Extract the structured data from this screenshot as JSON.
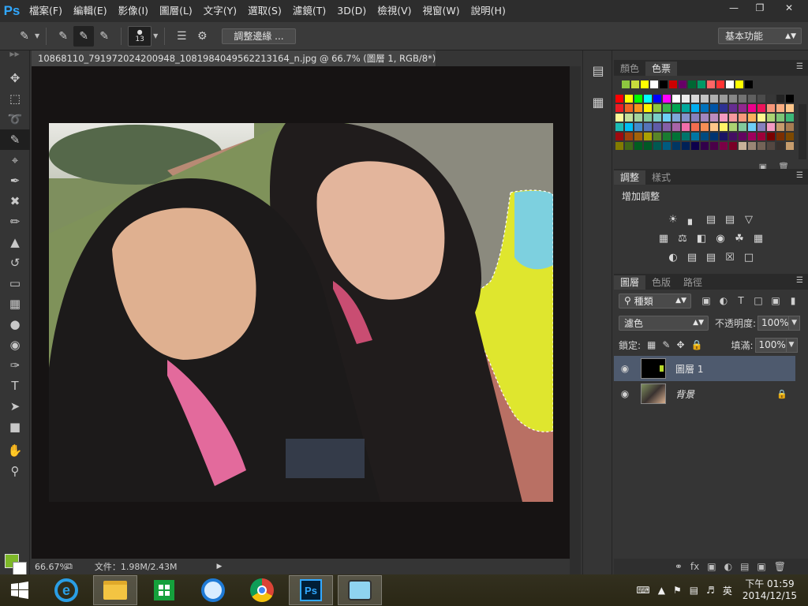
{
  "app": {
    "logo": "Ps",
    "menu": [
      "檔案(F)",
      "編輯(E)",
      "影像(I)",
      "圖層(L)",
      "文字(Y)",
      "選取(S)",
      "濾鏡(T)",
      "3D(D)",
      "檢視(V)",
      "視窗(W)",
      "說明(H)"
    ]
  },
  "options": {
    "brush_size": "13",
    "refine_edge": "調整邊緣 ...",
    "workspace": "基本功能"
  },
  "document": {
    "tab_title": "10868110_791972024200948_1081984049562213164_n.jpg @ 66.7% (圖層 1, RGB/8*) *",
    "close": "×",
    "zoom": "66.67%",
    "doc_info": "文件：1.98M/2.43M"
  },
  "tools": [
    "move-tool-icon",
    "marquee-tool-icon",
    "lasso-tool-icon",
    "quick-selection-tool-icon",
    "crop-tool-icon",
    "eyedropper-tool-icon",
    "healing-tool-icon",
    "brush-tool-icon",
    "stamp-tool-icon",
    "history-brush-tool-icon",
    "eraser-tool-icon",
    "gradient-tool-icon",
    "blur-tool-icon",
    "dodge-tool-icon",
    "pen-tool-icon",
    "type-tool-icon",
    "path-selection-tool-icon",
    "shape-tool-icon",
    "hand-tool-icon",
    "zoom-tool-icon"
  ],
  "colors": {
    "foreground": "#7eb829",
    "background": "#ffffff",
    "selected_layer": "#4e5a6e"
  },
  "swatches_panel": {
    "tabs": [
      "顏色",
      "色票"
    ],
    "recent": [
      "#8dc63f",
      "#c8dc3c",
      "#ffff00",
      "#ffffff",
      "#000000",
      "#cc0000",
      "#660066",
      "#006633",
      "#009966",
      "#ff6666",
      "#ff3333",
      "#ffffff",
      "#ffff00",
      "#000000"
    ],
    "grid": [
      "#ff0000",
      "#ffff00",
      "#00ff00",
      "#00ffff",
      "#0000ff",
      "#ff00ff",
      "#ffffff",
      "#ebebeb",
      "#d7d7d7",
      "#c3c3c3",
      "#afafaf",
      "#9b9b9b",
      "#878787",
      "#737373",
      "#5f5f5f",
      "#4b4b4b",
      "#373737",
      "#232323",
      "#000000",
      "#ed1c24",
      "#f26522",
      "#f7941d",
      "#fff200",
      "#8dc63f",
      "#39b54a",
      "#00a651",
      "#00a99d",
      "#00aeef",
      "#0072bc",
      "#0054a6",
      "#2e3192",
      "#662d91",
      "#92278f",
      "#ec008c",
      "#ed145b",
      "#f69679",
      "#f9ad81",
      "#fdc68a",
      "#fff799",
      "#c4df9b",
      "#a3d39c",
      "#82ca9d",
      "#7accc8",
      "#6dcff6",
      "#7da7d9",
      "#8393ca",
      "#8781bd",
      "#a186be",
      "#bd8cbf",
      "#f49ac1",
      "#f5989d",
      "#f7977a",
      "#fbaf5c",
      "#fff68f",
      "#acd373",
      "#7cc576",
      "#3cb878",
      "#1cbbb4",
      "#00bff3",
      "#448ccb",
      "#5574b9",
      "#605ca8",
      "#855fa8",
      "#a864a8",
      "#f06eaa",
      "#f26c4f",
      "#f68e55",
      "#fdc689",
      "#fff467",
      "#acd372",
      "#82ca9c",
      "#6ecff6",
      "#8781bd",
      "#f49ac2",
      "#c69c6d",
      "#a67c52",
      "#9e0b0f",
      "#a0410d",
      "#a36209",
      "#aba000",
      "#598527",
      "#1a7b30",
      "#007236",
      "#00746b",
      "#0076a3",
      "#004b80",
      "#003471",
      "#1b1464",
      "#440e62",
      "#630460",
      "#9e005d",
      "#9e0039",
      "#790000",
      "#7b2e00",
      "#7d4900",
      "#827b00",
      "#406618",
      "#005e20",
      "#005826",
      "#005952",
      "#005b7f",
      "#003663",
      "#002157",
      "#0d004c",
      "#32004b",
      "#4b0049",
      "#7b0046",
      "#7a0026",
      "#c7b299",
      "#998675",
      "#736357",
      "#534741",
      "#37302d",
      "#c69c6d"
    ]
  },
  "adjustments_panel": {
    "tabs": [
      "調整",
      "樣式"
    ],
    "title": "增加調整",
    "row1": [
      "brightness-icon",
      "levels-icon",
      "curves-icon",
      "exposure-icon",
      "vibrance-icon"
    ],
    "row2": [
      "hue-sat-icon",
      "color-balance-icon",
      "bw-icon",
      "photo-filter-icon",
      "channel-mixer-icon",
      "color-lookup-icon"
    ],
    "row3": [
      "invert-icon",
      "posterize-icon",
      "threshold-icon",
      "selective-color-icon",
      "gradient-map-icon"
    ]
  },
  "layers_panel": {
    "tabs": [
      "圖層",
      "色版",
      "路徑"
    ],
    "filter_kind": "種類",
    "blend_mode": "濾色",
    "opacity_label": "不透明度:",
    "opacity_value": "100%",
    "lock_label": "鎖定:",
    "fill_label": "填滿:",
    "fill_value": "100%",
    "layers": [
      {
        "name": "圖層 1",
        "visible": true,
        "selected": true
      },
      {
        "name": "背景",
        "visible": true,
        "selected": false,
        "locked": true
      }
    ]
  },
  "taskbar": {
    "apps": [
      "ie-icon",
      "file-explorer-icon",
      "store-icon",
      "skype-icon",
      "chrome-icon",
      "photoshop-icon",
      "camera-app-icon"
    ],
    "ps_label": "Ps",
    "lang": "英",
    "time": "下午 01:59",
    "date": "2014/12/15"
  }
}
